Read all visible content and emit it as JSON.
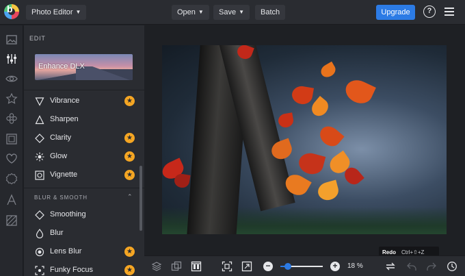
{
  "app": {
    "title": "Photo Editor"
  },
  "topbar": {
    "open_label": "Open",
    "save_label": "Save",
    "batch_label": "Batch",
    "upgrade_label": "Upgrade",
    "help_label": "?"
  },
  "rail": {
    "icons": [
      "image-icon",
      "sliders-icon",
      "eye-icon",
      "star-icon",
      "flower-icon",
      "frame-icon",
      "heart-icon",
      "badge-icon",
      "text-icon",
      "texture-icon"
    ]
  },
  "panel": {
    "heading": "EDIT",
    "enhance_label": "Enhance DLX",
    "items": [
      {
        "label": "Vibrance",
        "icon": "triangle-outline-icon",
        "premium": true
      },
      {
        "label": "Sharpen",
        "icon": "triangle-icon",
        "premium": false
      },
      {
        "label": "Clarity",
        "icon": "diamond-icon",
        "premium": true
      },
      {
        "label": "Glow",
        "icon": "sun-icon",
        "premium": true
      },
      {
        "label": "Vignette",
        "icon": "vignette-icon",
        "premium": true
      }
    ],
    "section_title": "BLUR & SMOOTH",
    "blur_items": [
      {
        "label": "Smoothing",
        "icon": "diamond-icon",
        "premium": false
      },
      {
        "label": "Blur",
        "icon": "drop-icon",
        "premium": false
      },
      {
        "label": "Lens Blur",
        "icon": "lens-icon",
        "premium": true
      },
      {
        "label": "Funky Focus",
        "icon": "focus-icon",
        "premium": true
      }
    ]
  },
  "tooltip": {
    "title": "Redo",
    "shortcut": "Ctrl+⇧+Z"
  },
  "bottombar": {
    "zoom_percent": "18 %",
    "zoom_fraction": 0.18
  },
  "colors": {
    "accent": "#2c7be5",
    "premium": "#f5a623",
    "panel": "#2a2c31"
  }
}
